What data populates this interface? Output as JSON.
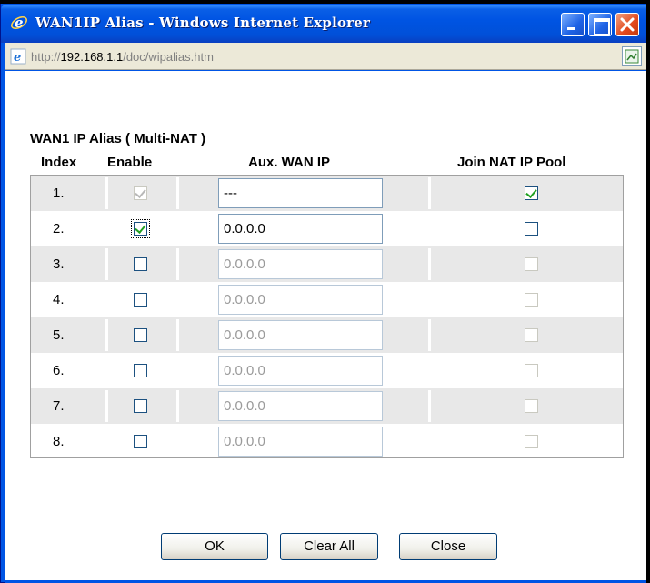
{
  "window": {
    "title": "WAN1IP Alias - Windows Internet Explorer",
    "address_prefix": "http://",
    "address_host": "192.168.1.1",
    "address_path": "/doc/wipalias.htm"
  },
  "section_title": "WAN1 IP Alias ( Multi-NAT )",
  "table": {
    "columns": [
      "Index",
      "Enable",
      "Aux. WAN IP",
      "Join NAT IP Pool"
    ],
    "rows": [
      {
        "index": "1.",
        "enable": true,
        "enable_disabled": true,
        "ip": "---",
        "ip_disabled": false,
        "join": true,
        "join_disabled": false
      },
      {
        "index": "2.",
        "enable": true,
        "enable_disabled": false,
        "ip": "0.0.0.0",
        "ip_disabled": false,
        "join": false,
        "join_disabled": false
      },
      {
        "index": "3.",
        "enable": false,
        "enable_disabled": false,
        "ip": "0.0.0.0",
        "ip_disabled": true,
        "join": false,
        "join_disabled": true
      },
      {
        "index": "4.",
        "enable": false,
        "enable_disabled": false,
        "ip": "0.0.0.0",
        "ip_disabled": true,
        "join": false,
        "join_disabled": true
      },
      {
        "index": "5.",
        "enable": false,
        "enable_disabled": false,
        "ip": "0.0.0.0",
        "ip_disabled": true,
        "join": false,
        "join_disabled": true
      },
      {
        "index": "6.",
        "enable": false,
        "enable_disabled": false,
        "ip": "0.0.0.0",
        "ip_disabled": true,
        "join": false,
        "join_disabled": true
      },
      {
        "index": "7.",
        "enable": false,
        "enable_disabled": false,
        "ip": "0.0.0.0",
        "ip_disabled": true,
        "join": false,
        "join_disabled": true
      },
      {
        "index": "8.",
        "enable": false,
        "enable_disabled": false,
        "ip": "0.0.0.0",
        "ip_disabled": true,
        "join": false,
        "join_disabled": true
      }
    ]
  },
  "buttons": {
    "ok": "OK",
    "clear_all": "Clear All",
    "close": "Close"
  },
  "icons": {
    "app": "ie-logo-icon",
    "address": "ie-page-icon",
    "page": "page-status-icon"
  },
  "colors": {
    "titlebar": "#0054e3",
    "check": "#21a121",
    "row_shade": "#e8e8e8"
  }
}
